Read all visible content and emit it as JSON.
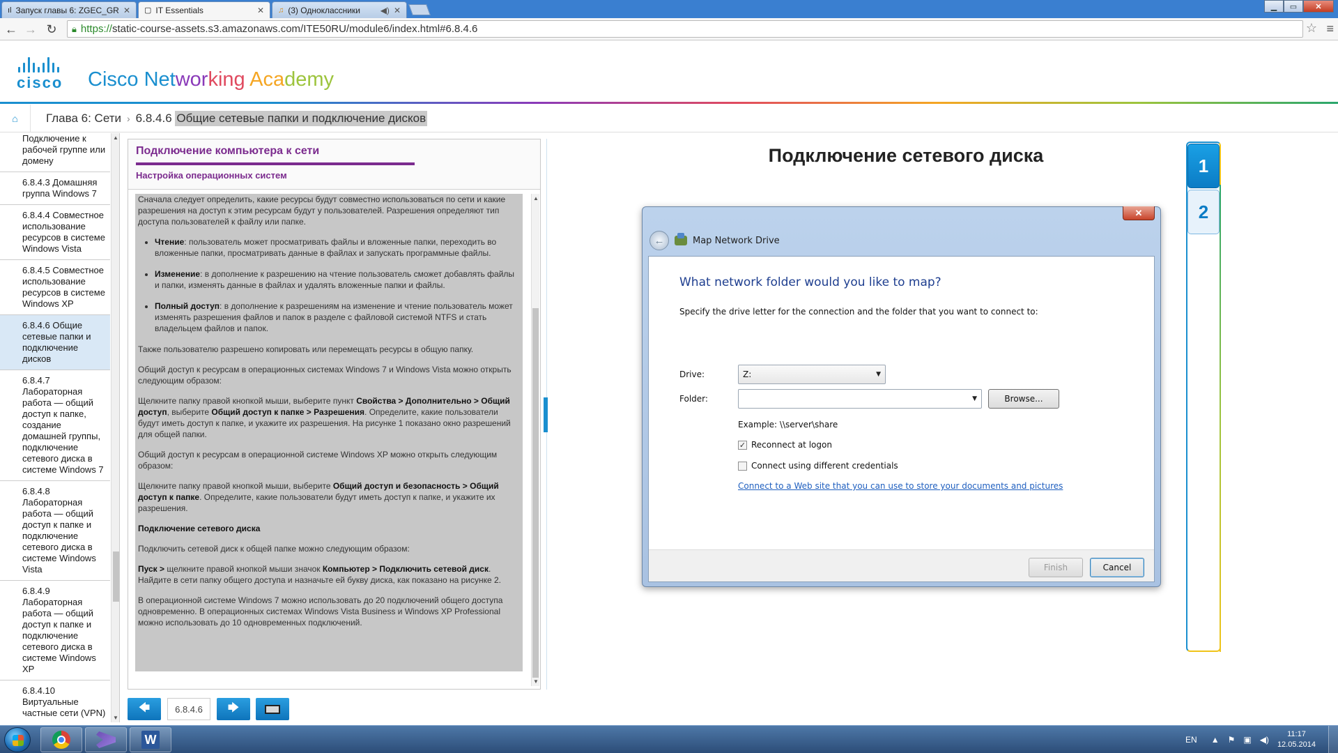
{
  "browser": {
    "tabs": [
      {
        "title": "Запуск главы 6: ZGEC_GR",
        "icon": "cisco-bars-icon",
        "active": false
      },
      {
        "title": "IT Essentials",
        "icon": "page-icon",
        "active": true
      },
      {
        "title": "(3) Одноклассники",
        "icon": "music-icon",
        "active": false
      }
    ],
    "url_scheme": "https://",
    "url_rest": "static-course-assets.s3.amazonaws.com/ITE50RU/module6/index.html#6.8.4.6"
  },
  "header": {
    "logo_text": "cisco",
    "title_parts": [
      {
        "text": "Cisco ",
        "color": "#1a8fcf"
      },
      {
        "text": "Net",
        "color": "#1a8fcf"
      },
      {
        "text": "wor",
        "color": "#8a3ab9"
      },
      {
        "text": "king ",
        "color": "#e04a5f"
      },
      {
        "text": "Aca",
        "color": "#f5a623"
      },
      {
        "text": "demy",
        "color": "#9dc43d"
      }
    ]
  },
  "breadcrumb": {
    "chapter": "Глава 6: Сети",
    "sep": "›",
    "section_num": "6.8.4.6",
    "section_title": "Общие сетевые папки и подключение дисков"
  },
  "sidebar": {
    "items": [
      {
        "label": "Подключение к рабочей группе или домену",
        "selected": false
      },
      {
        "label": "6.8.4.3 Домашняя группа Windows 7",
        "selected": false
      },
      {
        "label": "6.8.4.4 Совместное использование ресурсов в системе Windows Vista",
        "selected": false
      },
      {
        "label": "6.8.4.5 Совместное использование ресурсов в системе Windows XP",
        "selected": false
      },
      {
        "label": "6.8.4.6 Общие сетевые папки и подключение дисков",
        "selected": true
      },
      {
        "label": "6.8.4.7 Лабораторная работа — общий доступ к папке, создание домашней группы, подключение сетевого диска в системе Windows 7",
        "selected": false
      },
      {
        "label": "6.8.4.8 Лабораторная работа — общий доступ к папке и подключение сетевого диска в системе Windows Vista",
        "selected": false
      },
      {
        "label": "6.8.4.9 Лабораторная работа — общий доступ к папке и подключение сетевого диска в системе Windows XP",
        "selected": false
      },
      {
        "label": "6.8.4.10 Виртуальные частные сети (VPN)",
        "selected": false
      }
    ]
  },
  "panel": {
    "title": "Подключение компьютера к сети",
    "subtitle": "Настройка операционных систем",
    "p1": "Сначала следует определить, какие ресурсы будут совместно использоваться по сети и какие разрешения на доступ к этим ресурсам будут у пользователей. Разрешения определяют тип доступа пользователей к файлу или папке.",
    "li1_b": "Чтение",
    "li1": ": пользователь может просматривать файлы и вложенные папки, переходить во вложенные папки, просматривать данные в файлах и запускать программные файлы.",
    "li2_b": "Изменение",
    "li2": ": в дополнение к разрешению на чтение пользователь сможет добавлять файлы и папки, изменять данные в файлах и удалять вложенные папки и файлы.",
    "li3_b": "Полный доступ",
    "li3": ": в дополнение к разрешениям на изменение и чтение пользователь может изменять разрешения файлов и папок в разделе с файловой системой NTFS и стать владельцем файлов и папок.",
    "p2": "Также пользователю разрешено копировать или перемещать ресурсы в общую папку.",
    "p3": "Общий доступ к ресурсам в операционных системах Windows 7 и Windows Vista можно открыть следующим образом:",
    "p4_a": "Щелкните папку правой кнопкой мыши, выберите пункт ",
    "p4_b1": "Свойства > Дополнительно > Общий доступ",
    "p4_c": ", выберите ",
    "p4_b2": "Общий доступ к папке > Разрешения",
    "p4_d": ". Определите, какие пользователи будут иметь доступ к папке, и укажите их разрешения. На рисунке 1 показано окно разрешений для общей папки.",
    "p5": "Общий доступ к ресурсам в операционной системе Windows XP можно открыть следующим образом:",
    "p6_a": "Щелкните папку правой кнопкой мыши, выберите ",
    "p6_b": "Общий доступ и безопасность > Общий доступ к папке",
    "p6_c": ". Определите, какие пользователи будут иметь доступ к папке, и укажите их разрешения.",
    "h1": "Подключение сетевого диска",
    "p7": "Подключить сетевой диск к общей папке можно следующим образом:",
    "p8_b1": "Пуск >",
    "p8_a": " щелкните правой кнопкой мыши значок ",
    "p8_b2": "Компьютер > Подключить сетевой диск",
    "p8_c": ". Найдите в сети папку общего доступа и назначьте ей букву диска, как показано на рисунке 2.",
    "p9": "В операционной системе Windows 7 можно использовать до 20 подключений общего доступа одновременно. В операционных системах Windows Vista Business и Windows XP Professional можно использовать до 10 одновременных подключений."
  },
  "bottom_nav": {
    "prev_icon": "arrow-left-icon",
    "page": "6.8.4.6",
    "next_icon": "arrow-right-icon",
    "screen_icon": "screen-icon"
  },
  "figure": {
    "title": "Подключение сетевого диска",
    "dialog": {
      "title": "Map Network Drive",
      "question": "What network folder would you like to map?",
      "description": "Specify the drive letter for the connection and the folder that you want to connect to:",
      "drive_label": "Drive:",
      "drive_value": "Z:",
      "folder_label": "Folder:",
      "folder_value": "",
      "browse": "Browse...",
      "example": "Example: \\\\server\\share",
      "reconnect": "Reconnect at logon",
      "reconnect_checked": true,
      "different_credentials": "Connect using different credentials",
      "different_credentials_checked": false,
      "link": "Connect to a Web site that you can use to store your documents and pictures",
      "finish": "Finish",
      "cancel": "Cancel"
    },
    "selector": [
      "1",
      "2"
    ],
    "active_index": 0
  },
  "taskbar": {
    "lang": "EN",
    "time": "11:17",
    "date": "12.05.2014"
  }
}
